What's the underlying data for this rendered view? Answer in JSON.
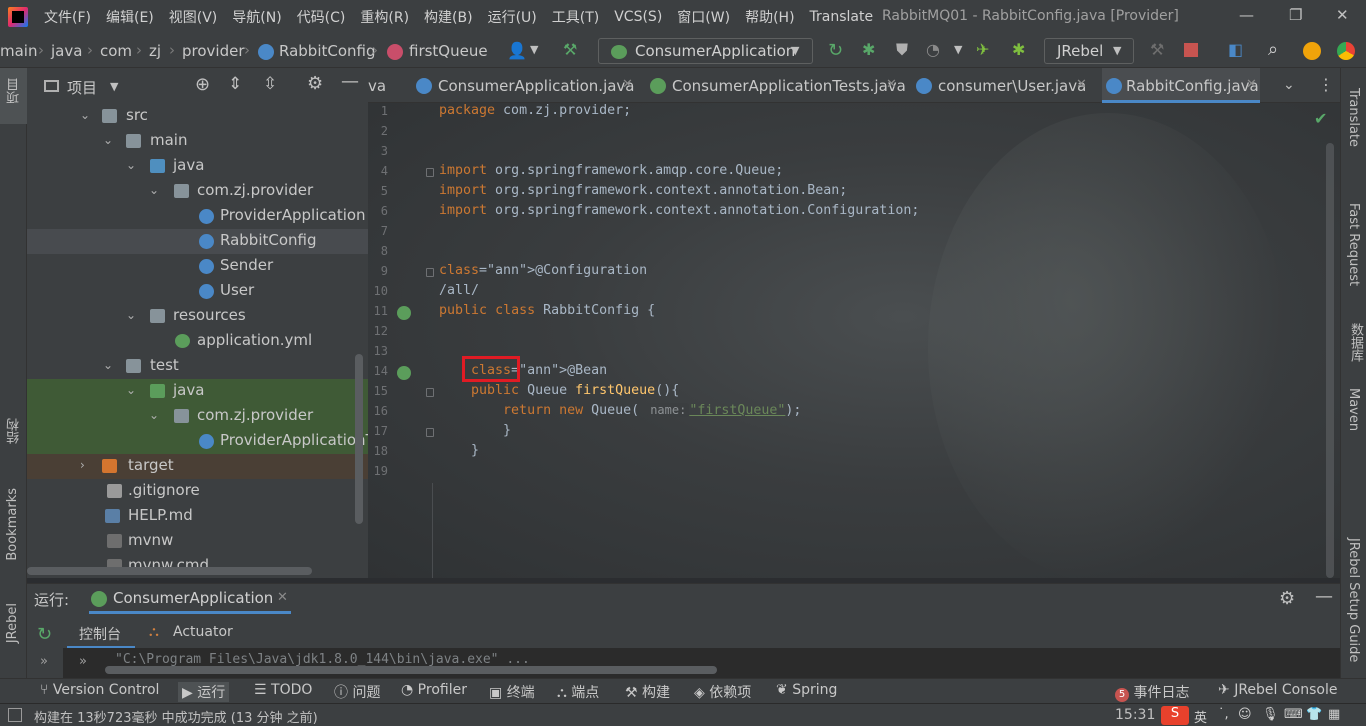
{
  "title_bar": {
    "menu": [
      "文件(F)",
      "编辑(E)",
      "视图(V)",
      "导航(N)",
      "代码(C)",
      "重构(R)",
      "构建(B)",
      "运行(U)",
      "工具(T)",
      "VCS(S)",
      "窗口(W)",
      "帮助(H)",
      "Translate"
    ],
    "window_title": "RabbitMQ01 - RabbitConfig.java [Provider]"
  },
  "navbar": {
    "breadcrumbs": [
      "main",
      "java",
      "com",
      "zj",
      "provider",
      "RabbitConfig",
      "firstQueue"
    ],
    "run_config": "ConsumerApplication",
    "jrebel_select": "JRebel"
  },
  "left_strip": {
    "project_label": "项目",
    "structure_label": "结构",
    "bookmarks_label": "Bookmarks",
    "jrebel_label": "JRebel"
  },
  "right_strip": {
    "translate": "Translate",
    "fast_request": "Fast Request",
    "database": "数据库",
    "maven": "Maven",
    "jrebel_setup": "JRebel Setup Guide"
  },
  "project_panel": {
    "header": "项目",
    "tree": [
      {
        "label": "src",
        "type": "folder"
      },
      {
        "label": "main",
        "type": "folder"
      },
      {
        "label": "java",
        "type": "folder-blue"
      },
      {
        "label": "com.zj.provider",
        "type": "package"
      },
      {
        "label": "ProviderApplication",
        "type": "spring-class"
      },
      {
        "label": "RabbitConfig",
        "type": "class"
      },
      {
        "label": "Sender",
        "type": "class"
      },
      {
        "label": "User",
        "type": "class"
      },
      {
        "label": "resources",
        "type": "folder"
      },
      {
        "label": "application.yml",
        "type": "yml"
      },
      {
        "label": "test",
        "type": "folder"
      },
      {
        "label": "java",
        "type": "folder-green"
      },
      {
        "label": "com.zj.provider",
        "type": "package"
      },
      {
        "label": "ProviderApplicationTe",
        "type": "spring-class"
      },
      {
        "label": "target",
        "type": "folder-orange"
      },
      {
        "label": ".gitignore",
        "type": "file"
      },
      {
        "label": "HELP.md",
        "type": "md"
      },
      {
        "label": "mvnw",
        "type": "file"
      },
      {
        "label": "mvnw.cmd",
        "type": "file"
      }
    ]
  },
  "editor": {
    "tabs": [
      {
        "label": "va",
        "partial": true
      },
      {
        "label": "ConsumerApplication.java"
      },
      {
        "label": "ConsumerApplicationTests.java"
      },
      {
        "label": "consumer\\User.java"
      },
      {
        "label": "RabbitConfig.java",
        "active": true
      }
    ],
    "lines": [
      {
        "n": "1",
        "text": "package com.zj.provider;"
      },
      {
        "n": "2",
        "text": ""
      },
      {
        "n": "3",
        "text": ""
      },
      {
        "n": "4",
        "text": "import org.springframework.amqp.core.Queue;"
      },
      {
        "n": "5",
        "text": "import org.springframework.context.annotation.Bean;"
      },
      {
        "n": "6",
        "text": "import org.springframework.context.annotation.Configuration;"
      },
      {
        "n": "7",
        "text": ""
      },
      {
        "n": "8",
        "text": ""
      },
      {
        "n": "9",
        "text": "@Configuration"
      },
      {
        "n": "10",
        "text": "/all/"
      },
      {
        "n": "11",
        "text": "public class RabbitConfig {"
      },
      {
        "n": "12",
        "text": ""
      },
      {
        "n": "13",
        "text": ""
      },
      {
        "n": "14",
        "text": "    @Bean"
      },
      {
        "n": "15",
        "text": "    public Queue firstQueue(){"
      },
      {
        "n": "16",
        "text": "        return new Queue( name: \"firstQueue\");"
      },
      {
        "n": "17",
        "text": "        }"
      },
      {
        "n": "18",
        "text": "    }"
      },
      {
        "n": "19",
        "text": ""
      }
    ],
    "param_hint": "name:",
    "string_literal": "\"firstQueue\""
  },
  "run_panel": {
    "label": "运行:",
    "tab": "ConsumerApplication",
    "subtabs": [
      "控制台",
      "Actuator"
    ],
    "console_line": "\"C:\\Program Files\\Java\\jdk1.8.0_144\\bin\\java.exe\" ..."
  },
  "tool_windows": [
    {
      "label": "Version Control"
    },
    {
      "label": "运行",
      "active": true
    },
    {
      "label": "TODO"
    },
    {
      "label": "问题"
    },
    {
      "label": "Profiler"
    },
    {
      "label": "终端"
    },
    {
      "label": "端点"
    },
    {
      "label": "构建"
    },
    {
      "label": "依赖项"
    },
    {
      "label": "Spring"
    },
    {
      "label": "事件日志",
      "badge": "5"
    },
    {
      "label": "JRebel Console"
    }
  ],
  "status_bar": {
    "message": "构建在 13秒723毫秒 中成功完成 (13 分钟 之前)",
    "time": "15:31",
    "ime": "英"
  },
  "colors": {
    "accent": "#4a88c7",
    "annotation": "#bbb529",
    "keyword": "#cc7832",
    "string": "#6a8759",
    "highlight_box": "#e01b24"
  }
}
